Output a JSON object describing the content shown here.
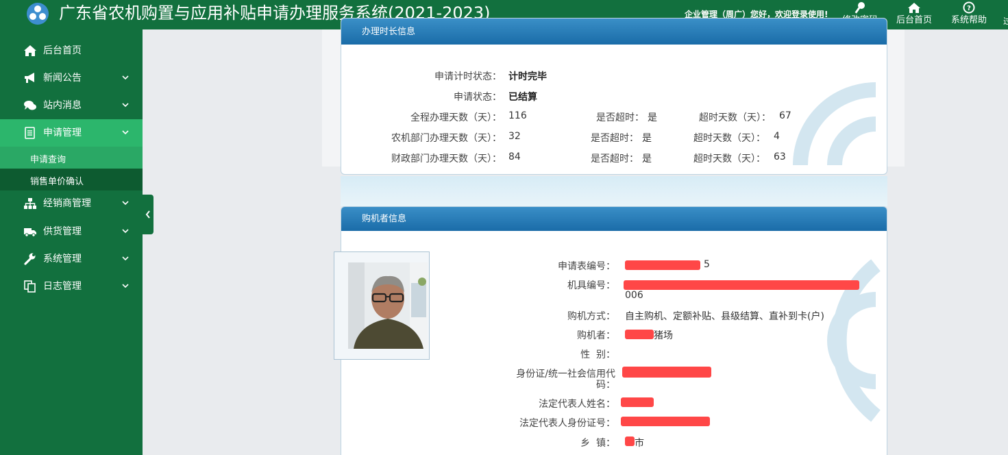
{
  "header": {
    "title": "广东省农机购置与应用补贴申请办理服务系统(2021-2023)",
    "greeting": "企业管理（周广）您好，欢迎登录使用!",
    "buttons": [
      {
        "label": "修改密码",
        "icon": "key-icon"
      },
      {
        "label": "后台首页",
        "icon": "home-icon"
      },
      {
        "label": "系统帮助",
        "icon": "help-icon"
      }
    ],
    "edge_text": "过"
  },
  "sidebar": {
    "items": [
      {
        "label": "后台首页",
        "icon": "home-icon"
      },
      {
        "label": "新闻公告",
        "icon": "megaphone-icon"
      },
      {
        "label": "站内消息",
        "icon": "chat-icon"
      },
      {
        "label": "申请管理",
        "icon": "document-icon"
      },
      {
        "label": "经销商管理",
        "icon": "org-chart-icon"
      },
      {
        "label": "供货管理",
        "icon": "truck-icon"
      },
      {
        "label": "系统管理",
        "icon": "wrench-icon"
      },
      {
        "label": "日志管理",
        "icon": "copy-icon"
      }
    ],
    "subitems": [
      {
        "label": "申请查询"
      },
      {
        "label": "销售单价确认"
      }
    ],
    "active_color": "#2cb66c"
  },
  "duration_panel": {
    "title": "办理时长信息",
    "timer_status_label": "申请计时状态：",
    "timer_status_value": "计时完毕",
    "app_status_label": "申请状态：",
    "app_status_value": "已结算",
    "rows": [
      {
        "label": "全程办理天数（天）：",
        "days": "116",
        "overtime_label": "是否超时：",
        "overtime": "是",
        "over_days_label": "超时天数（天）：",
        "over_days": "67"
      },
      {
        "label": "农机部门办理天数（天）：",
        "days": "32",
        "overtime_label": "是否超时：",
        "overtime": "是",
        "over_days_label": "超时天数（天）：",
        "over_days": "4"
      },
      {
        "label": "财政部门办理天数（天）：",
        "days": "84",
        "overtime_label": "是否超时：",
        "overtime": "是",
        "over_days_label": "超时天数（天）：",
        "over_days": "63"
      }
    ]
  },
  "buyer_panel": {
    "title": "购机者信息",
    "fields": {
      "form_no_label": "申请表编号：",
      "form_no_tail": "5",
      "machine_no_label": "机具编号：",
      "machine_no_tail": "006",
      "purchase_method_label": "购机方式：",
      "purchase_method": "自主购机、定额补贴、县级结算、直补到卡(户)",
      "buyer_label": "购机者：",
      "buyer_tail": "猪场",
      "gender_label": "性  别：",
      "id_label_line1": "身份证/统一社会信用代",
      "id_label_line2": "码：",
      "legal_name_label": "法定代表人姓名：",
      "legal_id_label": "法定代表人身份证号：",
      "town_label": "乡  镇：",
      "town_tail": "市"
    }
  },
  "colors": {
    "brand_green": "#12703e",
    "panel_blue": "#1a6ca8",
    "redaction": "#ff4747"
  }
}
